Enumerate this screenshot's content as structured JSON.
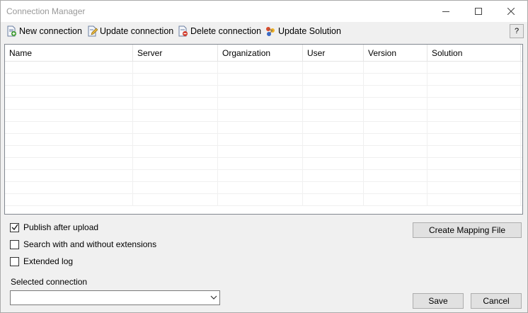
{
  "window": {
    "title": "Connection Manager"
  },
  "toolbar": {
    "new_label": "New connection",
    "update_label": "Update connection",
    "delete_label": "Delete connection",
    "solution_label": "Update Solution",
    "help_label": "?"
  },
  "grid": {
    "columns": [
      "Name",
      "Server",
      "Organization",
      "User",
      "Version",
      "Solution"
    ],
    "rows": []
  },
  "options": {
    "publish": {
      "label": "Publish after upload",
      "checked": true
    },
    "search": {
      "label": "Search with and without extensions",
      "checked": false
    },
    "extended": {
      "label": "Extended log",
      "checked": false
    }
  },
  "buttons": {
    "mapping_label": "Create Mapping File",
    "save_label": "Save",
    "cancel_label": "Cancel"
  },
  "selected_connection": {
    "label": "Selected connection",
    "value": ""
  }
}
